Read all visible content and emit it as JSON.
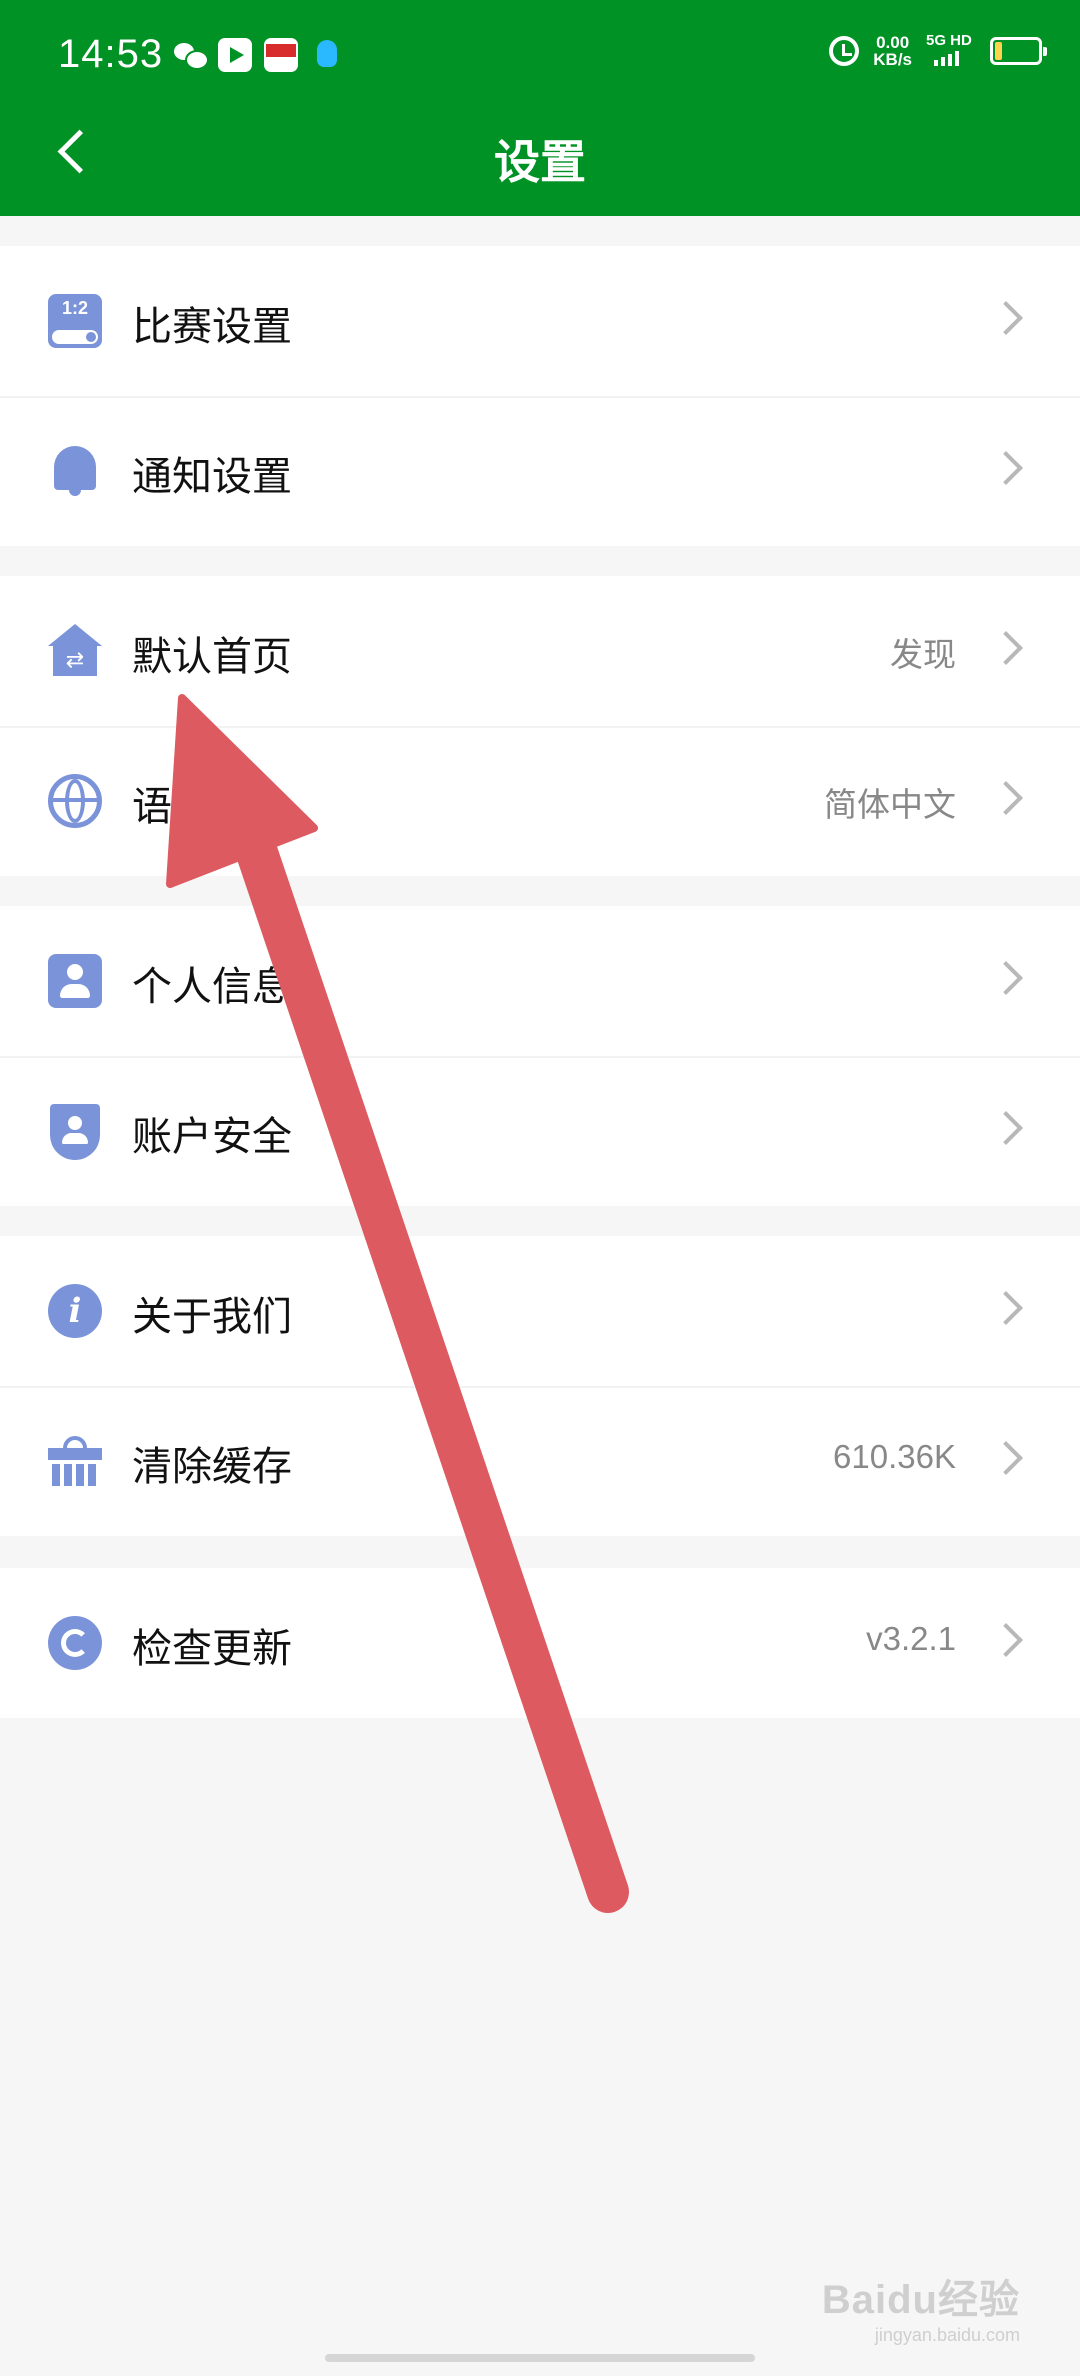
{
  "status_bar": {
    "time": "14:53",
    "net_speed_value": "0.00",
    "net_speed_unit": "KB/s",
    "network": "5G HD"
  },
  "header": {
    "title": "设置",
    "back_icon": "chevron-left-icon"
  },
  "groups": [
    {
      "items": [
        {
          "label": "比赛设置",
          "value": "",
          "icon": "match-score-icon"
        },
        {
          "label": "通知设置",
          "value": "",
          "icon": "bell-icon"
        }
      ]
    },
    {
      "items": [
        {
          "label": "默认首页",
          "value": "发现",
          "icon": "home-switch-icon"
        },
        {
          "label": "语言",
          "value": "简体中文",
          "icon": "globe-icon"
        }
      ]
    },
    {
      "items": [
        {
          "label": "个人信息",
          "value": "",
          "icon": "person-card-icon"
        },
        {
          "label": "账户安全",
          "value": "",
          "icon": "shield-user-icon"
        }
      ]
    },
    {
      "items": [
        {
          "label": "关于我们",
          "value": "",
          "icon": "info-icon"
        },
        {
          "label": "清除缓存",
          "value": "610.36K",
          "icon": "basket-icon"
        }
      ]
    },
    {
      "items": [
        {
          "label": "检查更新",
          "value": "v3.2.1",
          "icon": "refresh-icon"
        }
      ]
    }
  ],
  "watermark": {
    "text": "Baidu经验",
    "url": "jingyan.baidu.com"
  },
  "colors": {
    "header_bg": "#009224",
    "icon_accent": "#7b93d9",
    "annotation_arrow": "#dc5a60"
  }
}
